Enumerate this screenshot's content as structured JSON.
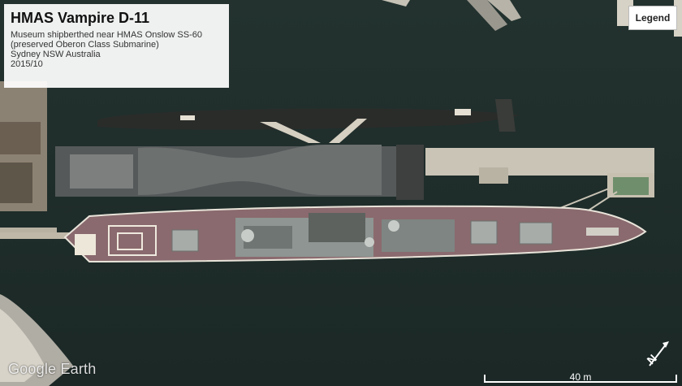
{
  "info": {
    "title": "HMAS Vampire D-11",
    "lines": [
      "Museum shipberthed near HMAS Onslow SS-60",
      "(preserved Oberon Class Submarine)",
      "Sydney NSW Australia",
      "2015/10"
    ]
  },
  "legend": {
    "label": "Legend"
  },
  "branding": {
    "logo_text": "Google Earth"
  },
  "scale": {
    "label": "40 m"
  },
  "compass": {
    "icon": "north-arrow-icon",
    "letter": "N"
  },
  "colors": {
    "water": "#1f2e2c",
    "deck": "#8a6a6e",
    "pier": "#c9c4b6",
    "shed_roof": "#5b5f5d",
    "sub_hull": "#2a2c2a"
  }
}
